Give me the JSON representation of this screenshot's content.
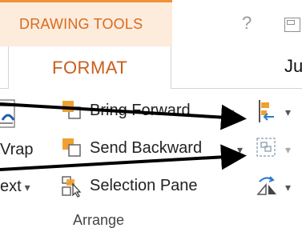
{
  "ribbon": {
    "context_tab_label": "DRAWING TOOLS",
    "active_tab_label": "FORMAT",
    "next_tab_label": "Ju",
    "help_label": "?",
    "wrap_text": {
      "top": "Vrap",
      "bottom": "ext"
    },
    "commands": {
      "bring_forward": "Bring Forward",
      "send_backward": "Send Backward",
      "selection_pane": "Selection Pane"
    },
    "group_label": "Arrange"
  },
  "colors": {
    "context_accent": "#f0913a",
    "context_fill": "#fdebdc",
    "tab_text": "#c95d1a",
    "annotation_arrow": "#000000",
    "icon_orange": "#f0a030",
    "icon_blue": "#2b7bd0"
  },
  "icons": [
    "bring-forward-icon",
    "send-backward-icon",
    "selection-pane-icon",
    "align-icon",
    "group-icon",
    "rotate-icon",
    "wrap-text-icon",
    "help-icon",
    "restore-icon"
  ]
}
